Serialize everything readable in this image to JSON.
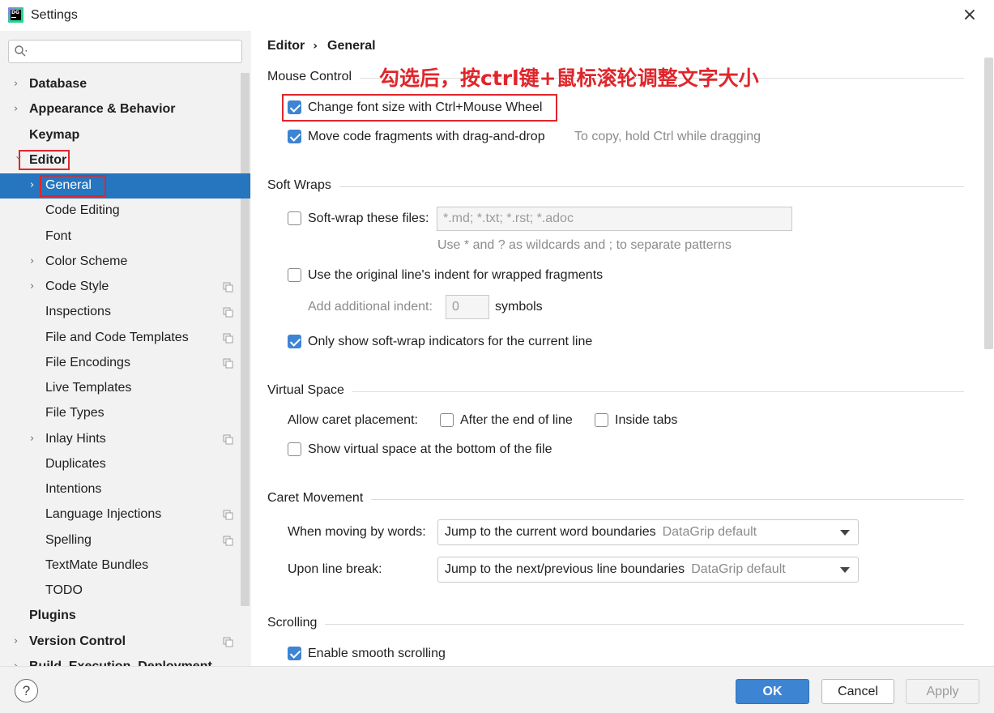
{
  "window": {
    "title": "Settings",
    "close_icon": "×"
  },
  "sidebar": {
    "search_placeholder": "",
    "items": [
      {
        "label": "Database",
        "bold": true
      },
      {
        "label": "Appearance & Behavior",
        "bold": true
      },
      {
        "label": "Keymap",
        "bold": true
      },
      {
        "label": "Editor",
        "bold": true
      },
      {
        "label": "General"
      },
      {
        "label": "Code Editing"
      },
      {
        "label": "Font"
      },
      {
        "label": "Color Scheme"
      },
      {
        "label": "Code Style"
      },
      {
        "label": "Inspections"
      },
      {
        "label": "File and Code Templates"
      },
      {
        "label": "File Encodings"
      },
      {
        "label": "Live Templates"
      },
      {
        "label": "File Types"
      },
      {
        "label": "Inlay Hints"
      },
      {
        "label": "Duplicates"
      },
      {
        "label": "Intentions"
      },
      {
        "label": "Language Injections"
      },
      {
        "label": "Spelling"
      },
      {
        "label": "TextMate Bundles"
      },
      {
        "label": "TODO"
      },
      {
        "label": "Plugins",
        "bold": true
      },
      {
        "label": "Version Control",
        "bold": true
      },
      {
        "label": "Build, Execution, Deployment",
        "bold": true
      }
    ]
  },
  "breadcrumb": {
    "parent": "Editor",
    "separator": "›",
    "current": "General"
  },
  "annotation": "勾选后，按ctrl键+鼠标滚轮调整文字大小",
  "sections": {
    "mouse_control": {
      "title": "Mouse Control",
      "change_font": {
        "label": "Change font size with Ctrl+Mouse Wheel",
        "checked": true
      },
      "move_code": {
        "label": "Move code fragments with drag-and-drop",
        "checked": true,
        "hint": "To copy, hold Ctrl while dragging"
      }
    },
    "soft_wraps": {
      "title": "Soft Wraps",
      "soft_wrap_files": {
        "label": "Soft-wrap these files:",
        "checked": false,
        "value": "*.md; *.txt; *.rst; *.adoc"
      },
      "wildcard_hint": "Use * and ? as wildcards and ; to separate patterns",
      "original_indent": {
        "label": "Use the original line's indent for wrapped fragments",
        "checked": false
      },
      "additional_indent": {
        "label": "Add additional indent:",
        "value": "0",
        "suffix": "symbols"
      },
      "only_show_indicators": {
        "label": "Only show soft-wrap indicators for the current line",
        "checked": true
      }
    },
    "virtual_space": {
      "title": "Virtual Space",
      "allow_caret": "Allow caret placement:",
      "after_end": {
        "label": "After the end of line",
        "checked": false
      },
      "inside_tabs": {
        "label": "Inside tabs",
        "checked": false
      },
      "show_virtual": {
        "label": "Show virtual space at the bottom of the file",
        "checked": false
      }
    },
    "caret_movement": {
      "title": "Caret Movement",
      "by_words": {
        "label": "When moving by words:",
        "value": "Jump to the current word boundaries",
        "default": "DataGrip default"
      },
      "line_break": {
        "label": "Upon line break:",
        "value": "Jump to the next/previous line boundaries",
        "default": "DataGrip default"
      }
    },
    "scrolling": {
      "title": "Scrolling",
      "smooth": {
        "label": "Enable smooth scrolling",
        "checked": true
      }
    }
  },
  "footer": {
    "help": "?",
    "ok": "OK",
    "cancel": "Cancel",
    "apply": "Apply"
  },
  "colors": {
    "accent": "#3d84d2",
    "selection": "#2675bf",
    "highlight_box": "#e0262b"
  }
}
